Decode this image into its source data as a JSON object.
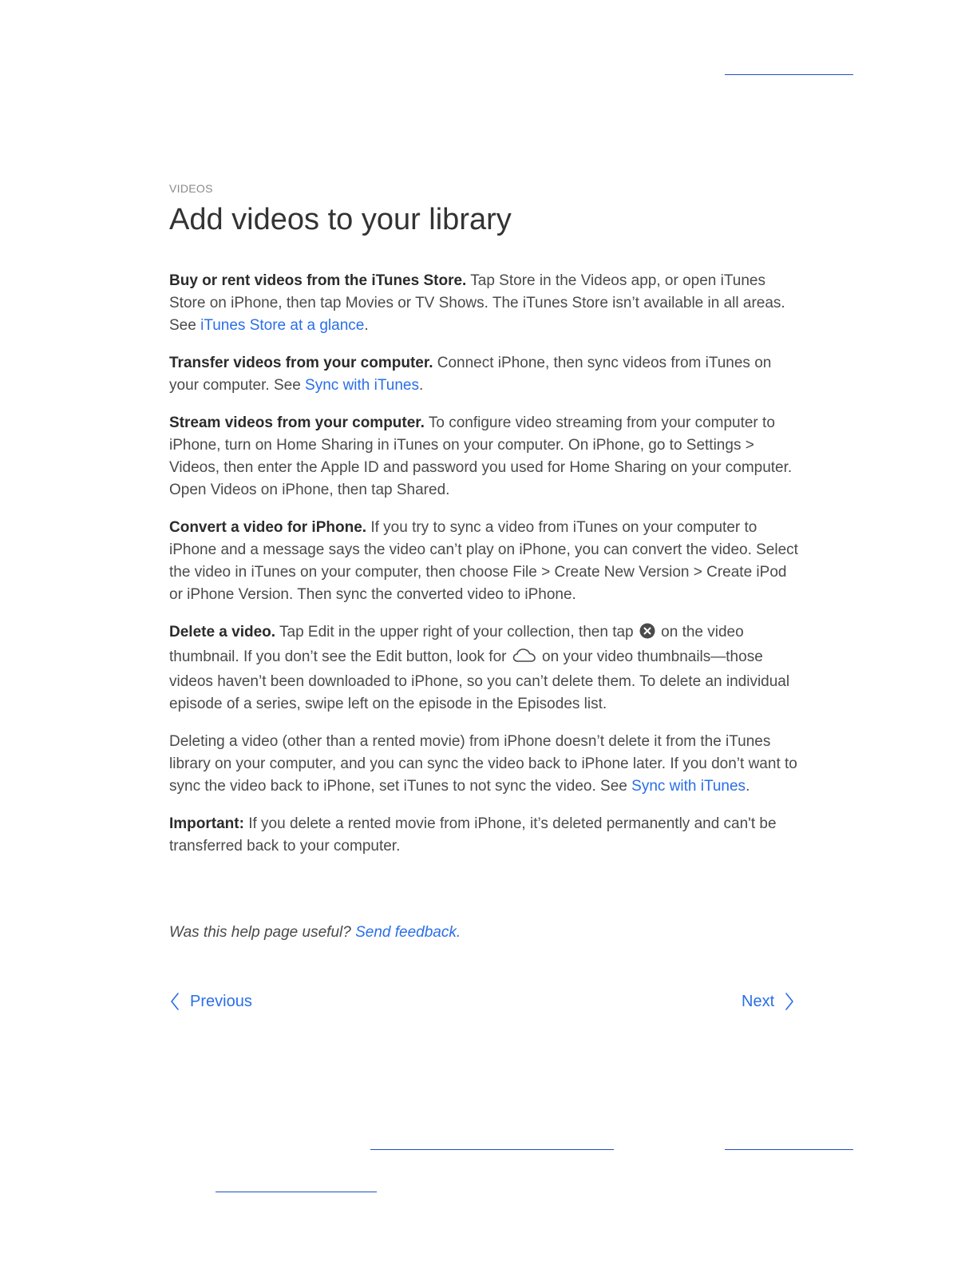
{
  "header": {
    "eyebrow": "VIDEOS",
    "title": "Add videos to your library"
  },
  "paragraphs": {
    "p1": {
      "lead": "Buy or rent videos from the iTunes Store.",
      "text": " Tap Store in the Videos app, or open iTunes Store on iPhone, then tap Movies or TV Shows. The iTunes Store isn’t available in all areas. See ",
      "link": "iTunes Store at a glance",
      "tail": "."
    },
    "p2": {
      "lead": "Transfer videos from your computer.",
      "text": " Connect iPhone, then sync videos from iTunes on your computer. See ",
      "link": "Sync with iTunes",
      "tail": "."
    },
    "p3": {
      "lead": "Stream videos from your computer.",
      "text": " To configure video streaming from your computer to iPhone, turn on Home Sharing in iTunes on your computer. On iPhone, go to Settings > Videos, then enter the Apple ID and password you used for Home Sharing on your computer. Open Videos on iPhone, then tap Shared."
    },
    "p4": {
      "lead": "Convert a video for iPhone.",
      "text": " If you try to sync a video from iTunes on your computer to iPhone and a message says the video can’t play on iPhone, you can convert the video. Select the video in iTunes on your computer, then choose File > Create New Version > Create iPod or iPhone Version. Then sync the converted video to iPhone."
    },
    "p5": {
      "lead": "Delete a video.",
      "text_a": " Tap Edit in the upper right of your collection, then tap ",
      "text_b": " on the video thumbnail. If you don’t see the Edit button, look for ",
      "text_c": " on your video thumbnails—those videos haven’t been downloaded to iPhone, so you can’t delete them. To delete an individual episode of a series, swipe left on the episode in the Episodes list."
    },
    "p6": {
      "text": "Deleting a video (other than a rented movie) from iPhone doesn’t delete it from the iTunes library on your computer, and you can sync the video back to iPhone later. If you don’t want to sync the video back to iPhone, set iTunes to not sync the video. See ",
      "link": "Sync with iTunes",
      "tail": "."
    },
    "p7": {
      "lead": "Important:",
      "text": " If you delete a rented movie from iPhone, it’s deleted permanently and can't be transferred back to your computer."
    }
  },
  "feedback": {
    "question": "Was this help page useful? ",
    "link": "Send feedback."
  },
  "navigation": {
    "previous": "Previous",
    "next": "Next"
  },
  "icons": {
    "delete": "circle-x-icon",
    "cloud": "cloud-icon"
  },
  "colors": {
    "link": "#2a6ee8",
    "rule": "#1f4fbf",
    "body_text": "#4a4a4a"
  }
}
